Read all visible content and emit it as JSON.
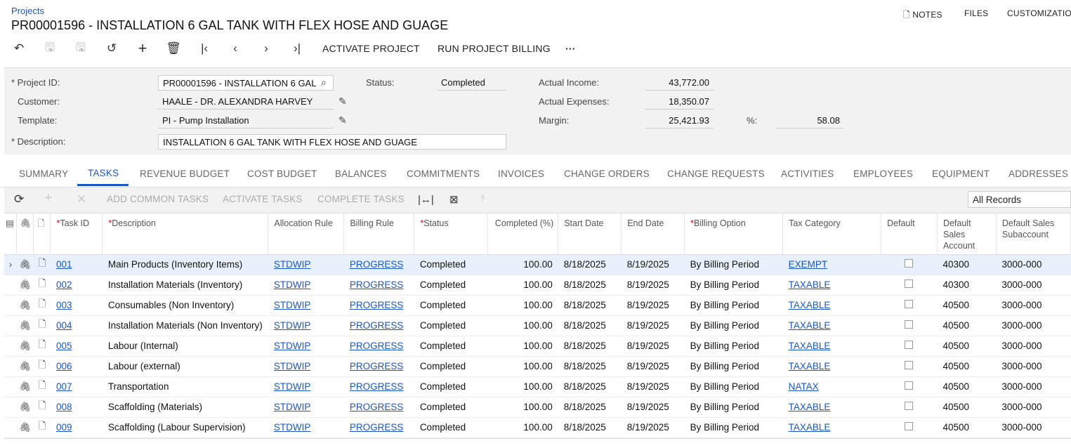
{
  "breadcrumb": "Projects",
  "title": "PR00001596 - INSTALLATION 6 GAL TANK WITH FLEX HOSE AND GUAGE",
  "top_actions": {
    "notes": "NOTES",
    "files": "FILES",
    "customization": "CUSTOMIZATIO"
  },
  "toolbar": {
    "activate_project": "ACTIVATE PROJECT",
    "run_billing": "RUN PROJECT BILLING",
    "more": "···"
  },
  "form": {
    "project_id_label": "Project ID:",
    "project_id_value": "PR00001596 - INSTALLATION 6 GAL",
    "customer_label": "Customer:",
    "customer_value": "HAALE - DR. ALEXANDRA HARVEY",
    "template_label": "Template:",
    "template_value": "PI - Pump Installation",
    "description_label": "Description:",
    "description_value": "INSTALLATION 6 GAL TANK WITH FLEX HOSE AND GUAGE",
    "status_label": "Status:",
    "status_value": "Completed",
    "actual_income_label": "Actual Income:",
    "actual_income_value": "43,772.00",
    "actual_expenses_label": "Actual Expenses:",
    "actual_expenses_value": "18,350.07",
    "margin_label": "Margin:",
    "margin_value": "25,421.93",
    "pct_label": "%:",
    "pct_value": "58.08"
  },
  "tabs": [
    "SUMMARY",
    "TASKS",
    "REVENUE BUDGET",
    "COST BUDGET",
    "BALANCES",
    "COMMITMENTS",
    "INVOICES",
    "CHANGE ORDERS",
    "CHANGE REQUESTS",
    "ACTIVITIES",
    "EMPLOYEES",
    "EQUIPMENT",
    "ADDRESSES"
  ],
  "active_tab": "TASKS",
  "grid_toolbar": {
    "add_common": "ADD COMMON TASKS",
    "activate": "ACTIVATE TASKS",
    "complete": "COMPLETE TASKS",
    "filter": "All Records"
  },
  "columns": {
    "task_id": "Task ID",
    "description": "Description",
    "allocation_rule": "Allocation Rule",
    "billing_rule": "Billing Rule",
    "status": "Status",
    "completed": "Completed (%)",
    "start_date": "Start Date",
    "end_date": "End Date",
    "billing_option": "Billing Option",
    "tax_category": "Tax Category",
    "default": "Default",
    "default_sales_account": "Default Sales Account",
    "default_sales_subaccount": "Default Sales Subaccount"
  },
  "rows": [
    {
      "task_id": "001",
      "description": "Main Products (Inventory Items)",
      "allocation": "STDWIP",
      "billing": "PROGRESS",
      "status": "Completed",
      "completed": "100.00",
      "start": "8/18/2025",
      "end": "8/19/2025",
      "option": "By Billing Period",
      "tax": "EXEMPT",
      "account": "40300",
      "subaccount": "3000-000"
    },
    {
      "task_id": "002",
      "description": "Installation Materials (Inventory)",
      "allocation": "STDWIP",
      "billing": "PROGRESS",
      "status": "Completed",
      "completed": "100.00",
      "start": "8/18/2025",
      "end": "8/19/2025",
      "option": "By Billing Period",
      "tax": "TAXABLE",
      "account": "40300",
      "subaccount": "3000-000"
    },
    {
      "task_id": "003",
      "description": "Consumables (Non Inventory)",
      "allocation": "STDWIP",
      "billing": "PROGRESS",
      "status": "Completed",
      "completed": "100.00",
      "start": "8/18/2025",
      "end": "8/19/2025",
      "option": "By Billing Period",
      "tax": "TAXABLE",
      "account": "40500",
      "subaccount": "3000-000"
    },
    {
      "task_id": "004",
      "description": "Installation Materials (Non Inventory)",
      "allocation": "STDWIP",
      "billing": "PROGRESS",
      "status": "Completed",
      "completed": "100.00",
      "start": "8/18/2025",
      "end": "8/19/2025",
      "option": "By Billing Period",
      "tax": "TAXABLE",
      "account": "40500",
      "subaccount": "3000-000"
    },
    {
      "task_id": "005",
      "description": "Labour (Internal)",
      "allocation": "STDWIP",
      "billing": "PROGRESS",
      "status": "Completed",
      "completed": "100.00",
      "start": "8/18/2025",
      "end": "8/19/2025",
      "option": "By Billing Period",
      "tax": "TAXABLE",
      "account": "40500",
      "subaccount": "3000-000"
    },
    {
      "task_id": "006",
      "description": "Labour (external)",
      "allocation": "STDWIP",
      "billing": "PROGRESS",
      "status": "Completed",
      "completed": "100.00",
      "start": "8/18/2025",
      "end": "8/19/2025",
      "option": "By Billing Period",
      "tax": "TAXABLE",
      "account": "40500",
      "subaccount": "3000-000"
    },
    {
      "task_id": "007",
      "description": "Transportation",
      "allocation": "STDWIP",
      "billing": "PROGRESS",
      "status": "Completed",
      "completed": "100.00",
      "start": "8/18/2025",
      "end": "8/19/2025",
      "option": "By Billing Period",
      "tax": "NATAX",
      "account": "40500",
      "subaccount": "3000-000"
    },
    {
      "task_id": "008",
      "description": "Scaffolding (Materials)",
      "allocation": "STDWIP",
      "billing": "PROGRESS",
      "status": "Completed",
      "completed": "100.00",
      "start": "8/18/2025",
      "end": "8/19/2025",
      "option": "By Billing Period",
      "tax": "TAXABLE",
      "account": "40500",
      "subaccount": "3000-000"
    },
    {
      "task_id": "009",
      "description": "Scaffolding (Labour Supervision)",
      "allocation": "STDWIP",
      "billing": "PROGRESS",
      "status": "Completed",
      "completed": "100.00",
      "start": "8/18/2025",
      "end": "8/19/2025",
      "option": "By Billing Period",
      "tax": "TAXABLE",
      "account": "40500",
      "subaccount": "3000-000"
    }
  ]
}
